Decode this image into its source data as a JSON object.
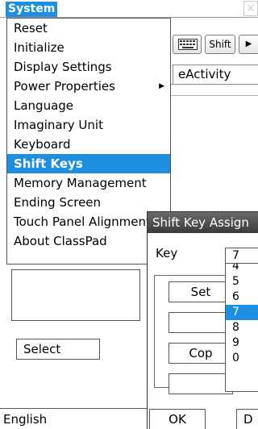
{
  "titlebar": {
    "system_label": "System",
    "close_symbol": "×"
  },
  "background_window": {
    "toolbar": {
      "keyboard_icon": "keyboard-icon",
      "shift_label": "Shift",
      "play_symbol": "▶"
    },
    "tab_label": "eActivity"
  },
  "menu": {
    "items": [
      {
        "label": "Reset"
      },
      {
        "label": "Initialize"
      },
      {
        "label": "Display Settings"
      },
      {
        "label": "Power Properties",
        "has_submenu": true
      },
      {
        "label": "Language"
      },
      {
        "label": "Imaginary Unit"
      },
      {
        "label": "Keyboard"
      },
      {
        "label": "Shift Keys",
        "selected": true
      },
      {
        "label": "Memory Management"
      },
      {
        "label": "Ending Screen"
      },
      {
        "label": "Touch Panel Alignment"
      },
      {
        "label": "About ClassPad"
      }
    ],
    "submenu_arrow": "▶"
  },
  "panel": {
    "select_label": "Select"
  },
  "status": {
    "language": "English"
  },
  "dialog": {
    "title": "Shift Key Assign",
    "key_label": "Key",
    "key_value": "7",
    "buttons": {
      "set": "Set",
      "copy": "Cop",
      "ok": "OK",
      "d": "D"
    },
    "options": [
      "4",
      "5",
      "6",
      "7",
      "8",
      "9",
      "0"
    ],
    "selected_option": "7"
  },
  "colors": {
    "accent": "#1e8ee0",
    "dialog_title": "#4a4a4a"
  }
}
